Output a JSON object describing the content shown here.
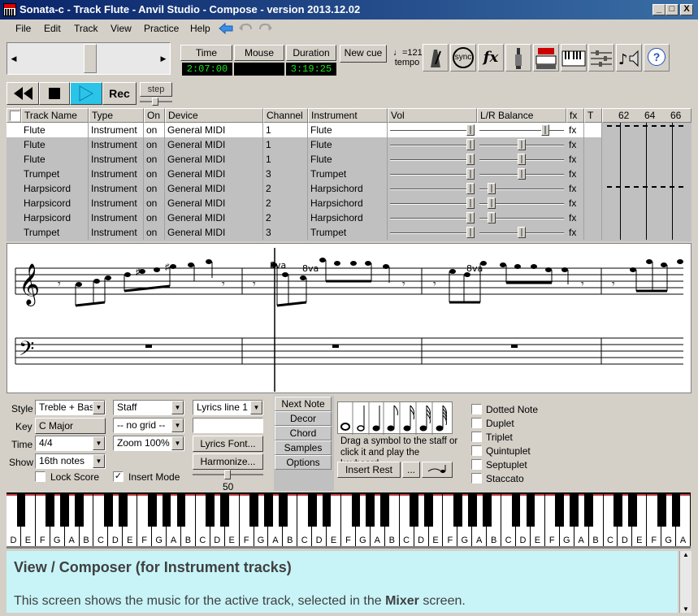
{
  "window": {
    "title": "Sonata-c - Track Flute - Anvil Studio - Compose - version 2013.12.02",
    "min_label": "_",
    "max_label": "□",
    "close_label": "X"
  },
  "menu": [
    "File",
    "Edit",
    "Track",
    "View",
    "Practice",
    "Help"
  ],
  "transport": {
    "time_label": "Time",
    "time_value": "2:07:00",
    "mouse_label": "Mouse",
    "mouse_value": "",
    "duration_label": "Duration",
    "duration_value": "3:19:25",
    "new_cue_label": "New cue",
    "tempo_value": "♩=121",
    "tempo_label": "tempo",
    "sync_label": "sync",
    "fx_label": "fx",
    "rec_label": "Rec",
    "step_label": "step"
  },
  "tracks": {
    "headers": [
      "Track Name",
      "Type",
      "On",
      "Device",
      "Channel",
      "Instrument",
      "Vol",
      "L/R Balance",
      "fx",
      "T"
    ],
    "measure_numbers": [
      "62",
      "64",
      "66"
    ],
    "rows": [
      {
        "name": "Flute",
        "type": "Instrument",
        "on": "on",
        "device": "General MIDI",
        "channel": "1",
        "instrument": "Flute",
        "fx": "fx",
        "vol": 0.95,
        "balance": 0.78
      },
      {
        "name": "Flute",
        "type": "Instrument",
        "on": "on",
        "device": "General MIDI",
        "channel": "1",
        "instrument": "Flute",
        "fx": "fx",
        "vol": 0.95,
        "balance": 0.5
      },
      {
        "name": "Flute",
        "type": "Instrument",
        "on": "on",
        "device": "General MIDI",
        "channel": "1",
        "instrument": "Flute",
        "fx": "fx",
        "vol": 0.95,
        "balance": 0.5
      },
      {
        "name": "Trumpet",
        "type": "Instrument",
        "on": "on",
        "device": "General MIDI",
        "channel": "3",
        "instrument": "Trumpet",
        "fx": "fx",
        "vol": 0.95,
        "balance": 0.5
      },
      {
        "name": "Harpsicord",
        "type": "Instrument",
        "on": "on",
        "device": "General MIDI",
        "channel": "2",
        "instrument": "Harpsichord",
        "fx": "fx",
        "vol": 0.95,
        "balance": 0.14
      },
      {
        "name": "Harpsicord",
        "type": "Instrument",
        "on": "on",
        "device": "General MIDI",
        "channel": "2",
        "instrument": "Harpsichord",
        "fx": "fx",
        "vol": 0.95,
        "balance": 0.14
      },
      {
        "name": "Harpsicord",
        "type": "Instrument",
        "on": "on",
        "device": "General MIDI",
        "channel": "2",
        "instrument": "Harpsichord",
        "fx": "fx",
        "vol": 0.95,
        "balance": 0.14
      },
      {
        "name": "Trumpet",
        "type": "Instrument",
        "on": "on",
        "device": "General MIDI",
        "channel": "3",
        "instrument": "Trumpet",
        "fx": "fx",
        "vol": 0.95,
        "balance": 0.5
      }
    ]
  },
  "score": {
    "ottava_labels": [
      "8va",
      "8va",
      "8va"
    ]
  },
  "controls": {
    "style_label": "Style",
    "style_value": "Treble + Bass",
    "key_label": "Key",
    "key_value": "C Major",
    "time_label": "Time",
    "time_value": "4/4",
    "show_label": "Show",
    "show_value": "16th notes",
    "lock_score_label": "Lock Score",
    "lock_score_checked": false,
    "staff_value": "Staff",
    "grid_value": "-- no grid --",
    "zoom_value": "Zoom 100%",
    "insert_mode_label": "Insert Mode",
    "insert_mode_checked": true,
    "lyrics_line_value": "Lyrics line 1",
    "lyrics_text_value": "",
    "lyrics_font_label": "Lyrics Font...",
    "harmonize_label": "Harmonize...",
    "slider_value": "50",
    "tabs": [
      "Next Note",
      "Decor",
      "Chord",
      "Samples",
      "Options"
    ],
    "drag_hint": "Drag a symbol to the staff or click it and play the keyboard",
    "insert_rest_label": "Insert Rest",
    "ellipsis_label": "...",
    "note_options": [
      {
        "label": "Dotted Note",
        "checked": false
      },
      {
        "label": "Duplet",
        "checked": false
      },
      {
        "label": "Triplet",
        "checked": false
      },
      {
        "label": "Quintuplet",
        "checked": false
      },
      {
        "label": "Septuplet",
        "checked": false
      },
      {
        "label": "Staccato",
        "checked": false
      }
    ]
  },
  "keyboard": {
    "white_keys": [
      "D",
      "E",
      "F",
      "G",
      "A",
      "B",
      "C",
      "D",
      "E",
      "F",
      "G",
      "A",
      "B",
      "C",
      "D",
      "E",
      "F",
      "G",
      "A",
      "B",
      "C",
      "D",
      "E",
      "F",
      "G",
      "A",
      "B",
      "C",
      "D",
      "E",
      "F",
      "G",
      "A",
      "B",
      "C",
      "D",
      "E",
      "F",
      "G",
      "A",
      "B",
      "C",
      "D",
      "E",
      "F",
      "G",
      "A"
    ]
  },
  "help": {
    "title": "View / Composer (for Instrument tracks)",
    "body_prefix": "This screen shows the music for the active track, selected in the ",
    "body_bold": "Mixer",
    "body_suffix": " screen."
  },
  "colors": {
    "lcd_text": "#19e619",
    "selection": "#ffffff",
    "help_bg": "#c8f4f8",
    "play_button": "#2bc4e8"
  }
}
